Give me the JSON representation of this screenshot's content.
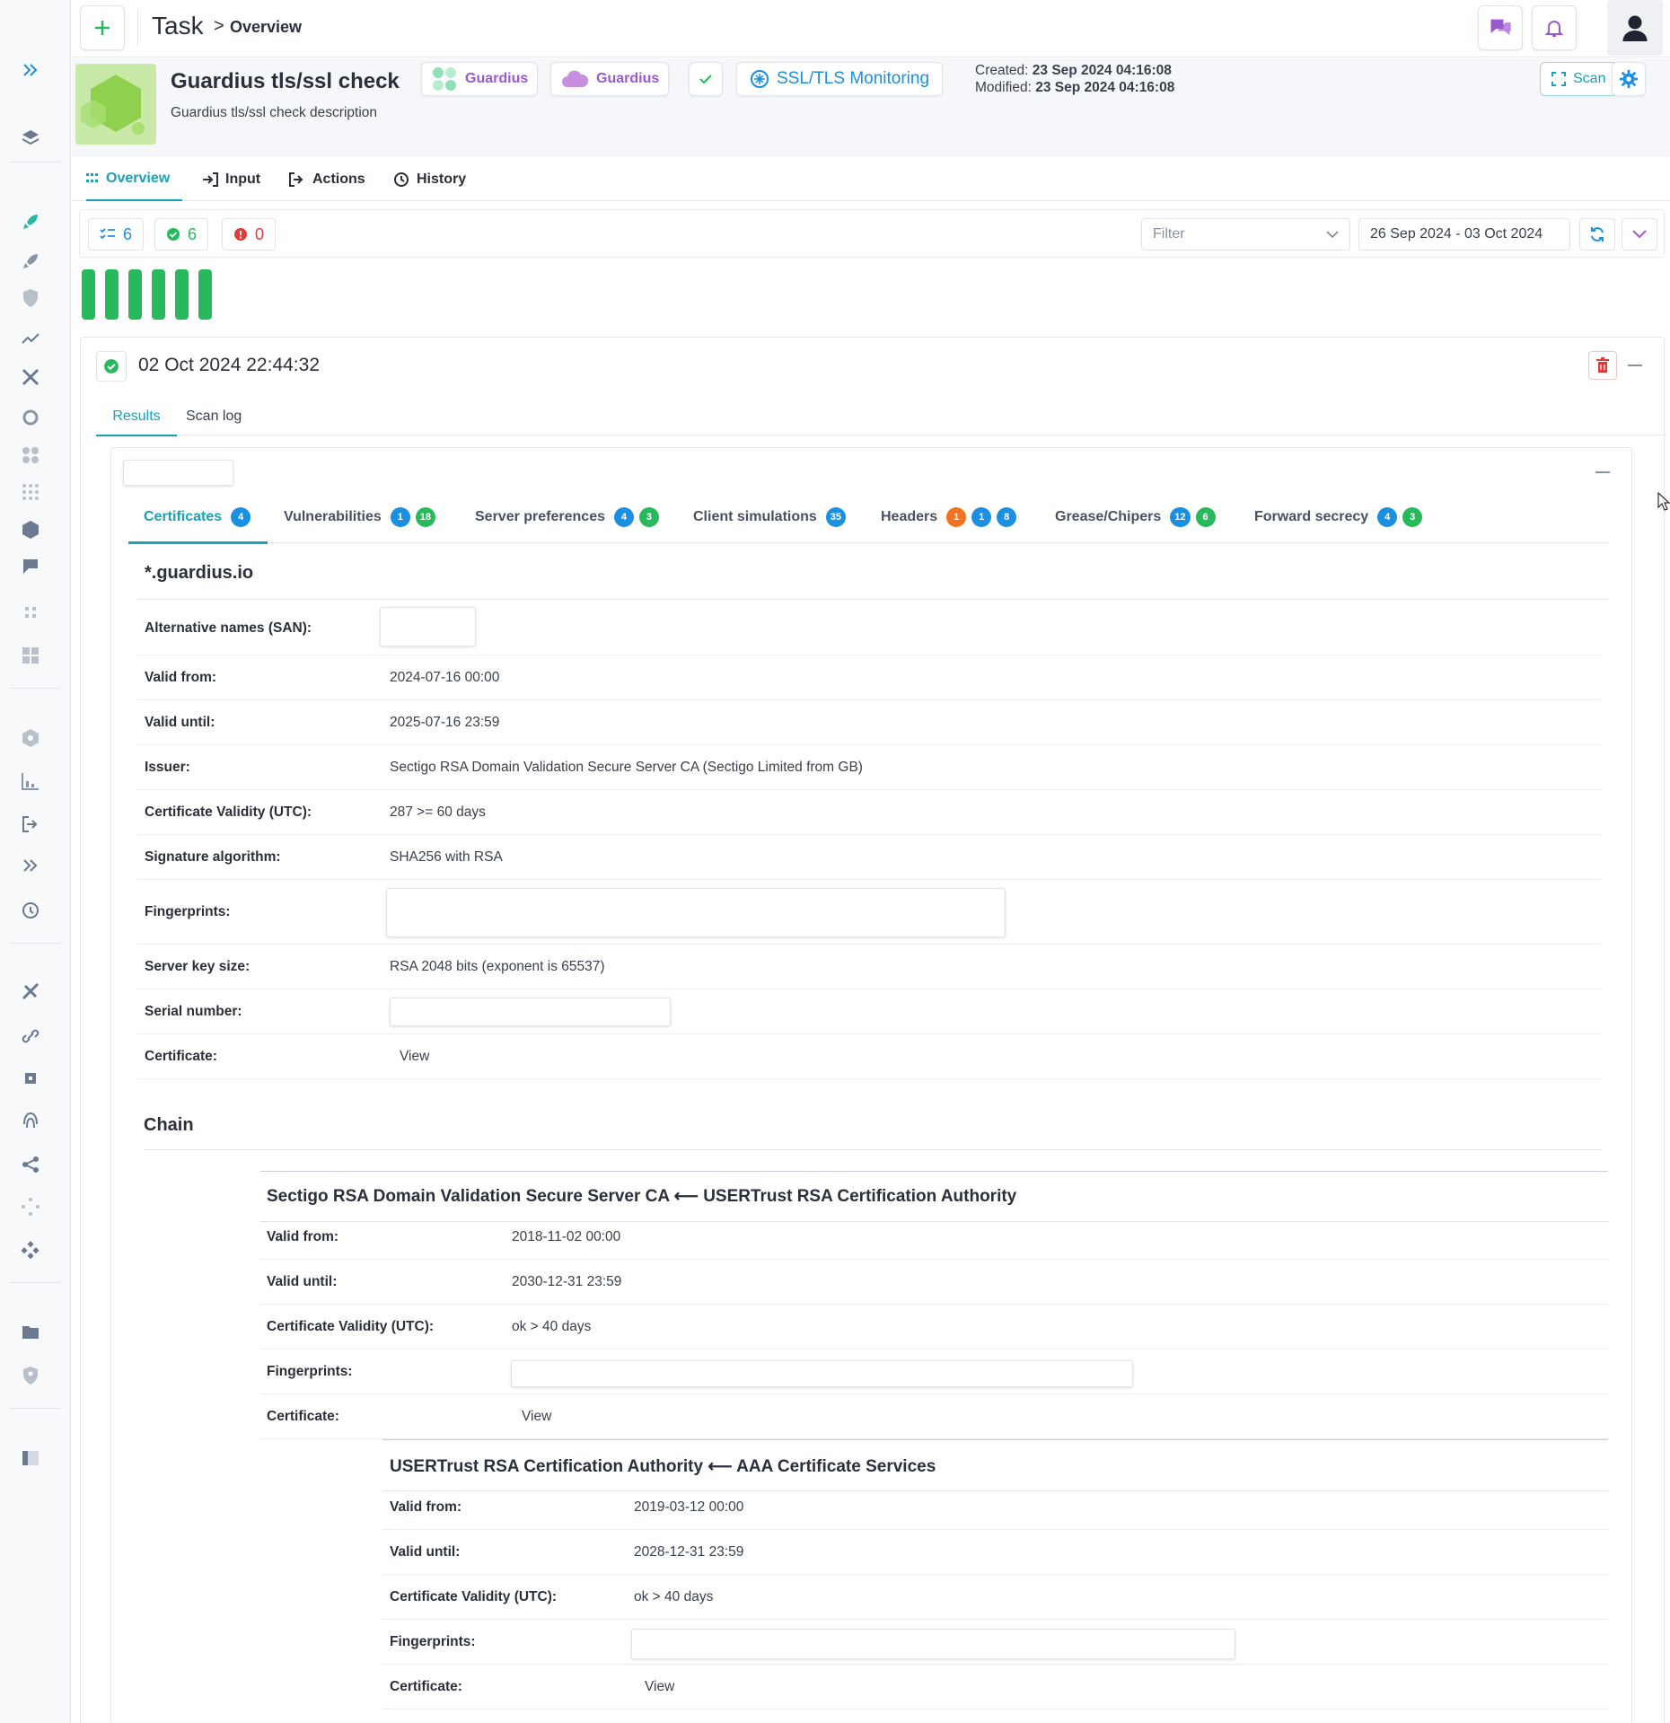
{
  "topbar": {
    "title": "Task",
    "breadcrumb_separator": ">",
    "breadcrumb": "Overview"
  },
  "header": {
    "name": "Guardius tls/ssl check",
    "description": "Guardius tls/ssl check description",
    "chip_org": "Guardius",
    "chip_cloud": "Guardius",
    "chip_type": "SSL/TLS Monitoring",
    "created_label": "Created:",
    "created_value": "23 Sep 2024 04:16:08",
    "modified_label": "Modified:",
    "modified_value": "23 Sep 2024 04:16:08",
    "scan_label": "Scan"
  },
  "tabs": [
    "Overview",
    "Input",
    "Actions",
    "History"
  ],
  "filterbar": {
    "total": "6",
    "ok": "6",
    "errors": "0",
    "filter_placeholder": "Filter",
    "date_range": "26 Sep 2024 - 03 Oct 2024"
  },
  "history_bars": [
    1,
    1,
    1,
    1,
    1,
    1
  ],
  "scan": {
    "timestamp": "02 Oct 2024 22:44:32",
    "tabs": [
      "Results",
      "Scan log"
    ]
  },
  "result_tabs": [
    {
      "label": "Certificates",
      "badges": [
        {
          "v": "4",
          "c": "blue"
        }
      ]
    },
    {
      "label": "Vulnerabilities",
      "badges": [
        {
          "v": "1",
          "c": "blue"
        },
        {
          "v": "18",
          "c": "green"
        }
      ]
    },
    {
      "label": "Server preferences",
      "badges": [
        {
          "v": "4",
          "c": "blue"
        },
        {
          "v": "3",
          "c": "green"
        }
      ]
    },
    {
      "label": "Client simulations",
      "badges": [
        {
          "v": "35",
          "c": "blue"
        }
      ]
    },
    {
      "label": "Headers",
      "badges": [
        {
          "v": "1",
          "c": "orange"
        },
        {
          "v": "1",
          "c": "blue"
        },
        {
          "v": "8",
          "c": "blue"
        }
      ]
    },
    {
      "label": "Grease/Chipers",
      "badges": [
        {
          "v": "12",
          "c": "blue"
        },
        {
          "v": "6",
          "c": "green"
        }
      ]
    },
    {
      "label": "Forward secrecy",
      "badges": [
        {
          "v": "4",
          "c": "blue"
        },
        {
          "v": "3",
          "c": "green"
        }
      ]
    }
  ],
  "certificate": {
    "domain": "*.guardius.io",
    "san_label": "Alternative names (SAN):",
    "valid_from_label": "Valid from:",
    "valid_from": "2024-07-16 00:00",
    "valid_until_label": "Valid until:",
    "valid_until": "2025-07-16 23:59",
    "issuer_label": "Issuer:",
    "issuer": "Sectigo RSA Domain Validation Secure Server CA (Sectigo Limited from GB)",
    "validity_label": "Certificate Validity (UTC):",
    "validity": "287 >= 60 days",
    "sig_label": "Signature algorithm:",
    "sig": "SHA256 with RSA",
    "fp_label": "Fingerprints:",
    "keysize_label": "Server key size:",
    "keysize": "RSA 2048 bits (exponent is 65537)",
    "serial_label": "Serial number:",
    "cert_label": "Certificate:",
    "cert_view": "View"
  },
  "chain": {
    "title": "Chain",
    "items": [
      {
        "title": "Sectigo RSA Domain Validation Secure Server CA ⟵ USERTrust RSA Certification Authority",
        "valid_from_label": "Valid from:",
        "valid_from": "2018-11-02 00:00",
        "valid_until_label": "Valid until:",
        "valid_until": "2030-12-31 23:59",
        "validity_label": "Certificate Validity (UTC):",
        "validity": "ok > 40 days",
        "fp_label": "Fingerprints:",
        "cert_label": "Certificate:",
        "cert_view": "View"
      },
      {
        "title": "USERTrust RSA Certification Authority ⟵ AAA Certificate Services",
        "valid_from_label": "Valid from:",
        "valid_from": "2019-03-12 00:00",
        "valid_until_label": "Valid until:",
        "valid_until": "2028-12-31 23:59",
        "validity_label": "Certificate Validity (UTC):",
        "validity": "ok > 40 days",
        "fp_label": "Fingerprints:",
        "cert_label": "Certificate:",
        "cert_view": "View"
      }
    ]
  },
  "colors": {
    "accent": "#17a2b8",
    "success": "#27b95c",
    "danger": "#e03a3a",
    "purple": "#9b59d0",
    "blue": "#1b8fe0"
  },
  "icons": {
    "sidebar": [
      "expand-icon",
      "layers-icon",
      "rocket-icon",
      "rocket-outline-icon",
      "shield-icon",
      "trend-icon",
      "tools-icon",
      "sync-icon",
      "apps-icon",
      "grid-dots-icon",
      "cube-icon",
      "mentions-icon",
      "small-grid-icon",
      "dashboard-icon",
      "hexagon-icon",
      "chart-icon",
      "logout-icon",
      "chevrons-icon",
      "history-icon",
      "satellite-icon",
      "link-icon",
      "chip-icon",
      "fingerprint-icon",
      "share-icon",
      "loader-icon",
      "diamond-icon",
      "folder-icon",
      "shield-user-icon",
      "panel-icon"
    ]
  }
}
